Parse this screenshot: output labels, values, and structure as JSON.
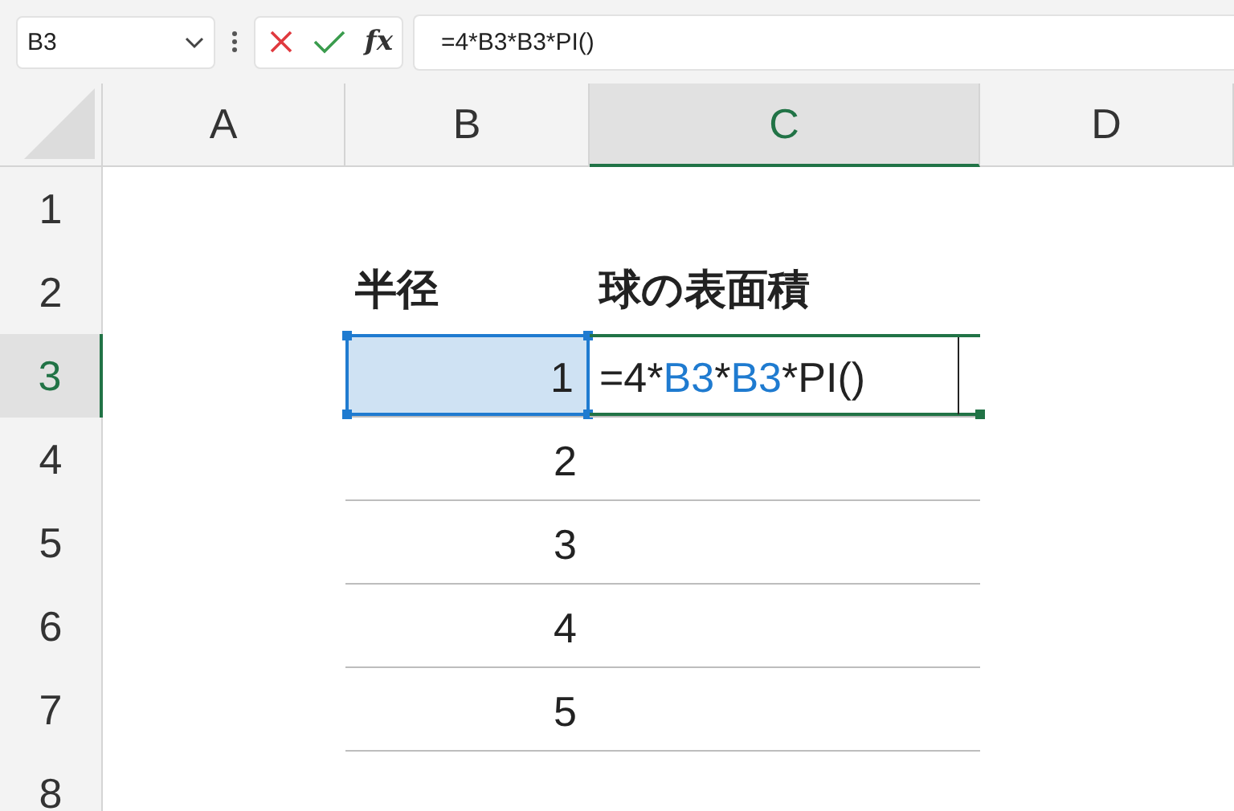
{
  "name_box": {
    "value": "B3"
  },
  "formula_bar": {
    "function_label": "fx",
    "value": "=4*B3*B3*PI()"
  },
  "columns": [
    {
      "label": "A",
      "selected": false
    },
    {
      "label": "B",
      "selected": false
    },
    {
      "label": "C",
      "selected": true
    },
    {
      "label": "D",
      "selected": false
    }
  ],
  "rows": [
    {
      "label": "1",
      "selected": false,
      "cells": {}
    },
    {
      "label": "2",
      "selected": false,
      "cells": {
        "B": {
          "kind": "heading",
          "text": "半径"
        },
        "C": {
          "kind": "heading",
          "text": "球の表面積"
        }
      }
    },
    {
      "label": "3",
      "selected": true,
      "cells": {
        "B": {
          "kind": "number",
          "text": "1",
          "referenced": true
        },
        "C": {
          "kind": "formula",
          "editing": true,
          "segments": [
            {
              "kind": "text",
              "text": "=4*"
            },
            {
              "kind": "ref",
              "text": "B3"
            },
            {
              "kind": "text",
              "text": "*"
            },
            {
              "kind": "ref",
              "text": "B3"
            },
            {
              "kind": "text",
              "text": "*PI()"
            }
          ]
        }
      }
    },
    {
      "label": "4",
      "selected": false,
      "cells": {
        "B": {
          "kind": "number",
          "text": "2"
        }
      }
    },
    {
      "label": "5",
      "selected": false,
      "cells": {
        "B": {
          "kind": "number",
          "text": "3"
        }
      }
    },
    {
      "label": "6",
      "selected": false,
      "cells": {
        "B": {
          "kind": "number",
          "text": "4"
        }
      }
    },
    {
      "label": "7",
      "selected": false,
      "cells": {
        "B": {
          "kind": "number",
          "text": "5"
        }
      }
    },
    {
      "label": "8",
      "selected": false,
      "cells": {}
    }
  ]
}
